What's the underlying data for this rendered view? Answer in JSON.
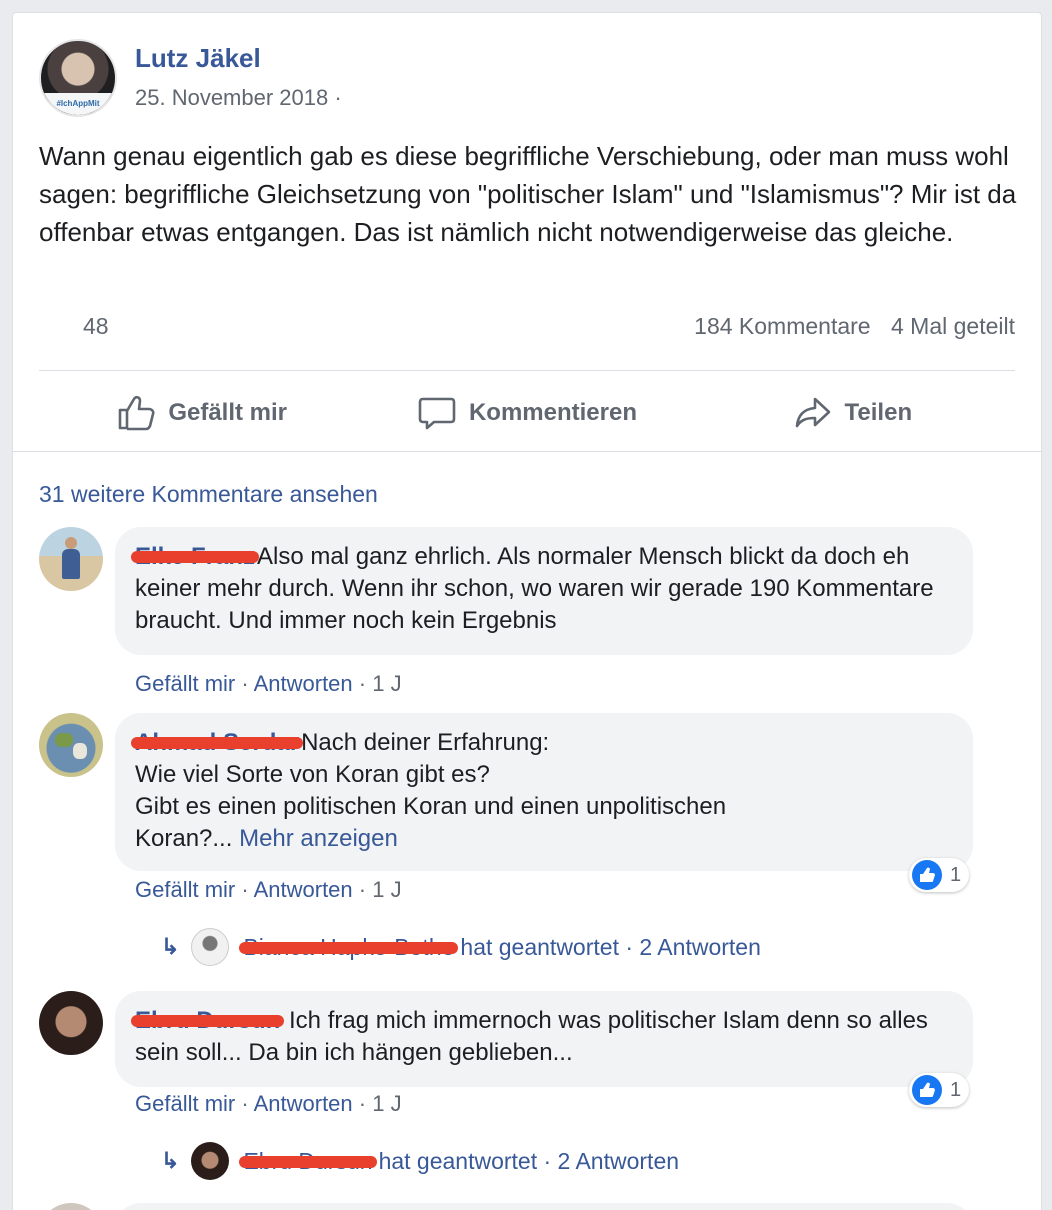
{
  "post": {
    "author": "Lutz Jäkel",
    "date": "25. November 2018 ·",
    "avatar_badge": "#IchAppMit",
    "text": "Wann genau eigentlich gab es diese begriffliche Verschiebung, oder man muss wohl sagen: begriffliche Gleichsetzung von \"politischer Islam\" und \"Islamismus\"? Mir ist da offenbar etwas entgangen. Das ist nämlich nicht notwendigerweise das gleiche.",
    "likes": "48",
    "comments_count": "184 Kommentare",
    "shares_count": "4 Mal geteilt"
  },
  "actions": {
    "like": "Gefällt mir",
    "comment": "Kommentieren",
    "share": "Teilen"
  },
  "more_comments": "31 weitere Kommentare ansehen",
  "comments": [
    {
      "name": "Elke Franz",
      "text": "Also mal ganz ehrlich. Als normaler Mensch blickt da doch eh keiner mehr durch. Wenn ihr schon, wo waren wir gerade 190 Kommentare braucht. Und immer noch kein Ergebnis",
      "like": "Gefällt mir",
      "reply": "Antworten",
      "time": "1 J"
    },
    {
      "name": "Ahmad Serdar",
      "line1": "Nach deiner Erfahrung:",
      "line2": "Wie viel Sorte von Koran gibt es?",
      "line3": "Gibt es einen politischen Koran und einen unpolitischen",
      "line4": "Koran?...",
      "more": "Mehr anzeigen",
      "reactions": "1",
      "like": "Gefällt mir",
      "reply": "Antworten",
      "time": "1 J",
      "reply_name": "Bianca Hapke-Bothe",
      "reply_text": "hat geantwortet · 2 Antworten"
    },
    {
      "name": "Ebru Dursun",
      "text": "Ich frag mich immernoch was politischer Islam denn so alles sein soll... Da bin ich hängen geblieben...",
      "reactions": "1",
      "like": "Gefällt mir",
      "reply": "Antworten",
      "time": "1 J",
      "reply_name": "Ebru Dursun",
      "reply_text": "hat geantwortet · 2 Antworten"
    }
  ],
  "colors": {
    "link": "#385898",
    "secondary": "#606770",
    "redaction": "#e8402d",
    "like_blue": "#1877f2"
  },
  "icons": [
    "thumbs-up-icon",
    "comment-bubble-icon",
    "share-arrow-icon",
    "reply-arrow-icon",
    "like-reaction-icon"
  ]
}
